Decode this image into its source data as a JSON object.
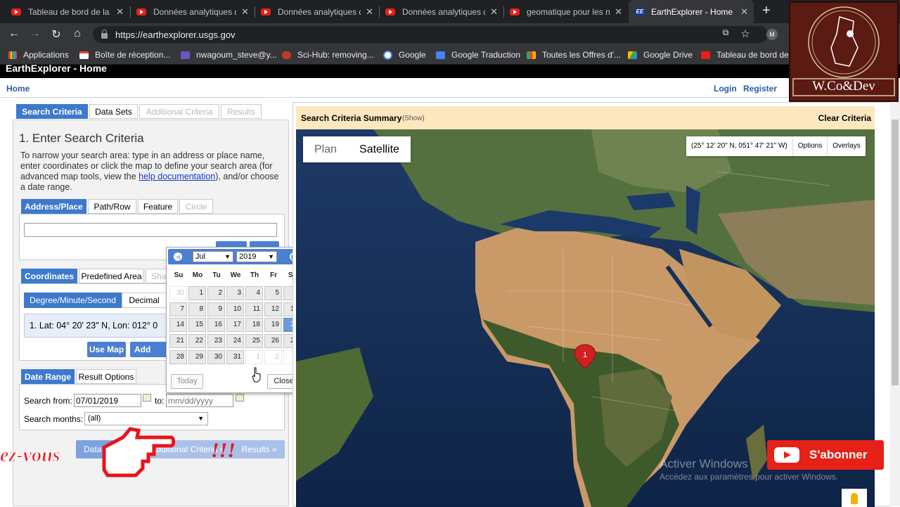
{
  "browser": {
    "tabs": [
      {
        "title": "Tableau de bord de la c",
        "icon": "youtube-icon",
        "active": false
      },
      {
        "title": "Données analytiques de",
        "icon": "youtube-icon",
        "active": false
      },
      {
        "title": "Données analytiques de",
        "icon": "youtube-icon",
        "active": false
      },
      {
        "title": "Données analytiques de",
        "icon": "youtube-icon",
        "active": false
      },
      {
        "title": "geomatique pour les n",
        "icon": "youtube-icon",
        "active": false
      },
      {
        "title": "EarthExplorer - Home",
        "icon": "earthexplorer-icon",
        "active": true
      }
    ],
    "new_tab": "+",
    "url": "https://earthexplorer.usgs.gov",
    "bookmarks": [
      {
        "label": "Applications",
        "icon": "apps-grid-icon"
      },
      {
        "label": "Boîte de réception...",
        "icon": "gmail-icon"
      },
      {
        "label": "nwagoum_steve@y...",
        "icon": "mail-icon"
      },
      {
        "label": "Sci-Hub: removing...",
        "icon": "scihub-icon"
      },
      {
        "label": "Google",
        "icon": "google-icon"
      },
      {
        "label": "Google Traduction",
        "icon": "translate-icon"
      },
      {
        "label": "Toutes les Offres d'...",
        "icon": "offers-icon"
      },
      {
        "label": "Google Drive",
        "icon": "drive-icon"
      },
      {
        "label": "Tableau de bord de...",
        "icon": "youtube-icon"
      }
    ]
  },
  "site": {
    "title": "EarthExplorer - Home",
    "home": "Home",
    "login": "Login",
    "register": "Register"
  },
  "left": {
    "tabs": [
      "Search Criteria",
      "Data Sets",
      "Additional Criteria",
      "Results"
    ],
    "heading": "1. Enter Search Criteria",
    "instructions_before": "To narrow your search area: type in an address or place name, enter coordinates or click the map to define your search area (for advanced map tools, view the ",
    "help_link": "help documentation",
    "instructions_after": "), and/or choose a date range.",
    "address_tabs": [
      "Address/Place",
      "Path/Row",
      "Feature",
      "Circle"
    ],
    "address_value": "",
    "coord_tabs": [
      "Coordinates",
      "Predefined Area",
      "Sha"
    ],
    "format_tabs": [
      "Degree/Minute/Second",
      "Decimal"
    ],
    "coordinate_entry": "1.  Lat: 04° 20' 23\" N, Lon: 012° 0",
    "use_map": "Use Map",
    "add_coord": "Add Coo",
    "date_tabs": [
      "Date Range",
      "Result Options"
    ],
    "search_from_label": "Search from:",
    "search_from_value": "07/01/2019",
    "to_label": "to:",
    "to_placeholder": "mm/dd/yyyy",
    "search_months_label": "Search months:",
    "search_months_value": "(all)",
    "bottom_btns": [
      "Data Sets »",
      "Additional Criteria »",
      "Results »"
    ]
  },
  "calendar": {
    "month": "Jul",
    "year": "2019",
    "dow": [
      "Su",
      "Mo",
      "Tu",
      "We",
      "Th",
      "Fr",
      "Sa"
    ],
    "weeks": [
      [
        "30",
        "1",
        "2",
        "3",
        "4",
        "5",
        "6"
      ],
      [
        "7",
        "8",
        "9",
        "10",
        "11",
        "12",
        "13"
      ],
      [
        "14",
        "15",
        "16",
        "17",
        "18",
        "19",
        "20"
      ],
      [
        "21",
        "22",
        "23",
        "24",
        "25",
        "26",
        "27"
      ],
      [
        "28",
        "29",
        "30",
        "31",
        "1",
        "2",
        "3"
      ]
    ],
    "selected_day": "20",
    "today": "Today",
    "close": "Close"
  },
  "map": {
    "summary_title": "Search Criteria Summary",
    "summary_show": "(Show)",
    "clear": "Clear Criteria",
    "toggle": [
      "Plan",
      "Satellite"
    ],
    "active_toggle": "Satellite",
    "cursor_coords": "(25° 12' 20\" N, 051° 47' 21\" W)",
    "options": "Options",
    "overlays": "Overlays",
    "marker_label": "1",
    "watermark_1": "Activer Windows",
    "watermark_2": "Accédez aux paramètres pour activer Windows."
  },
  "overlay": {
    "channel_logo": "W.Co&Dev",
    "subscribe": "S'abonner",
    "caption_left": "ez-vous",
    "caption_right": "!!!"
  },
  "colors": {
    "accent": "#3d79cc",
    "summary_bg": "#fde7bf",
    "subscribe_red": "#e62117"
  }
}
